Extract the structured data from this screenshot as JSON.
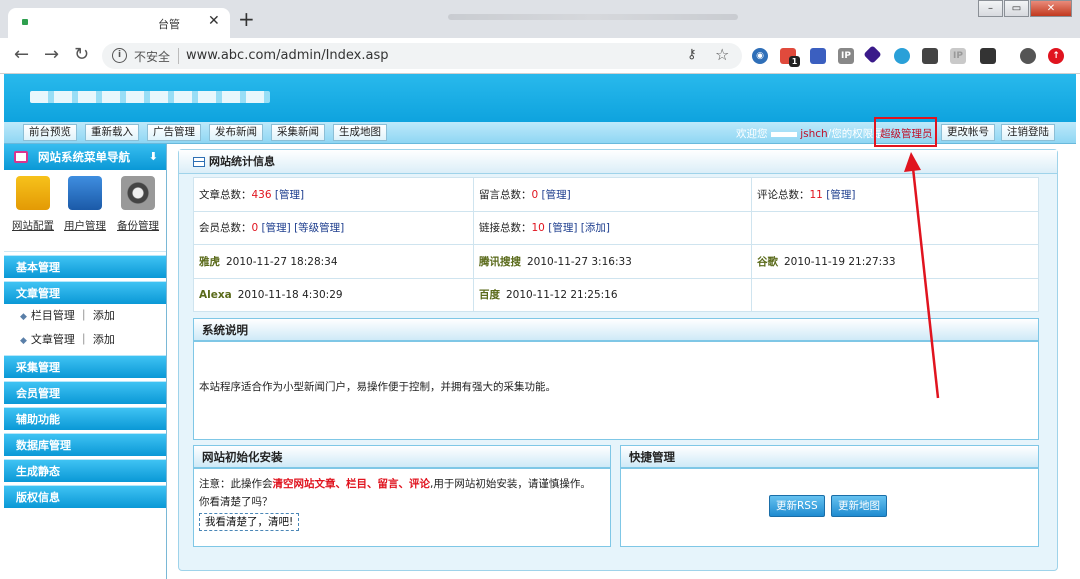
{
  "browser": {
    "tab_title": "台管",
    "url_insecure_label": "不安全",
    "url": "www.abc.com/admin/Index.asp",
    "ext_badge": "1"
  },
  "menubar": {
    "items": [
      "前台预览",
      "重新载入",
      "广告管理",
      "发布新闻",
      "采集新闻",
      "生成地图"
    ],
    "welcome_prefix": "欢迎您",
    "username": "jshch",
    "perm_text": "/您的权限是",
    "role": "超级管理员",
    "change_account": "更改帐号",
    "logout": "注销登陆"
  },
  "sidebar": {
    "title": "网站系统菜单导航",
    "quick_links": [
      {
        "label": "网站配置",
        "icon": "bird-icon"
      },
      {
        "label": "用户管理",
        "icon": "user-card-icon"
      },
      {
        "label": "备份管理",
        "icon": "backup-disc-icon"
      }
    ],
    "sections": [
      "基本管理",
      "文章管理",
      "采集管理",
      "会员管理",
      "辅助功能",
      "数据库管理",
      "生成静态",
      "版权信息"
    ],
    "article_subitems": [
      {
        "label": "栏目管理",
        "action": "添加"
      },
      {
        "label": "文章管理",
        "action": "添加"
      }
    ]
  },
  "main": {
    "title": "网站统计信息",
    "stats": {
      "article_label": "文章总数：",
      "article_count": "436",
      "message_label": "留言总数：",
      "message_count": "0",
      "comment_label": "评论总数：",
      "comment_count": "11",
      "member_label": "会员总数：",
      "member_count": "0",
      "link_label": "链接总数：",
      "link_count": "10",
      "manage": "[管理]",
      "level_manage": "[等级管理]",
      "add": "[添加]"
    },
    "spiders": [
      {
        "name": "雅虎",
        "time": "2010-11-27 18:28:34"
      },
      {
        "name": "腾讯搜搜",
        "time": "2010-11-27 3:16:33"
      },
      {
        "name": "谷歌",
        "time": "2010-11-19 21:27:33"
      },
      {
        "name": "Alexa",
        "time": "2010-11-18 4:30:29"
      },
      {
        "name": "百度",
        "time": "2010-11-12 21:25:16"
      }
    ],
    "system_title": "系统说明",
    "system_text": "本站程序适合作为小型新闻门户，易操作便于控制，并拥有强大的采集功能。",
    "init_title": "网站初始化安装",
    "init_note_prefix": "注意：此操作会",
    "init_note_red": "清空网站文章、栏目、留言、评论",
    "init_note_suffix": ",用于网站初始安装，请谨慎操作。",
    "init_confirm_q": "你看清楚了吗？",
    "init_button": "我看清楚了，清吧!",
    "quick_title": "快捷管理",
    "rss_button": "更新RSS",
    "map_button": "更新地图"
  },
  "colors": {
    "header_blue": "#0ea3de",
    "highlight_red": "#e0141f"
  }
}
